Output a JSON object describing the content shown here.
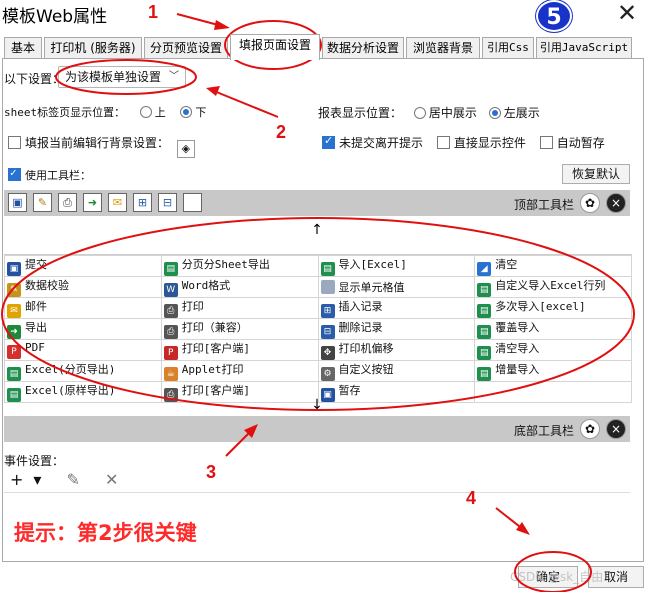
{
  "window": {
    "title": "模板Web属性"
  },
  "tabs": [
    {
      "label": "基本",
      "mono": false
    },
    {
      "label": "打印机 (服务器)",
      "mono": false
    },
    {
      "label": "分页预览设置",
      "mono": false
    },
    {
      "label": "填报页面设置",
      "mono": false,
      "active": true
    },
    {
      "label": "数据分析设置",
      "mono": false
    },
    {
      "label": "浏览器背景",
      "mono": false
    },
    {
      "label": "引用Css",
      "mono": true
    },
    {
      "label": "引用JavaScript",
      "mono": true
    }
  ],
  "settings": {
    "scope_label": "以下设置：",
    "scope_value": "为该模板单独设置",
    "sheet_tab_label": "sheet标签页显示位置：",
    "sheet_top": "上",
    "sheet_bottom": "下",
    "report_pos_label": "报表显示位置：",
    "report_center": "居中展示",
    "report_left": "左展示",
    "fill_row_bg": "填报当前编辑行背景设置：",
    "unsubmitted_leave": "未提交离开提示",
    "direct_show": "直接显示控件",
    "auto_save": "自动暂存",
    "use_toolbar": "使用工具栏：",
    "restore_default": "恢复默认"
  },
  "toolbar": {
    "top_label": "顶部工具栏",
    "bottom_label": "底部工具栏",
    "up_arrow": "↑",
    "down_arrow": "↓"
  },
  "grid": [
    [
      {
        "icon": "save",
        "t": "提交"
      },
      {
        "icon": "sheet",
        "t": "分页分Sheet导出"
      },
      {
        "icon": "sheet",
        "t": "导入[Excel]"
      },
      {
        "icon": "eraser",
        "t": "清空"
      }
    ],
    [
      {
        "icon": "pen",
        "t": "数据校验"
      },
      {
        "icon": "word",
        "t": "Word格式"
      },
      {
        "icon": "blank",
        "t": "显示单元格值"
      },
      {
        "icon": "sheet",
        "t": "自定义导入Excel行列"
      }
    ],
    [
      {
        "icon": "mail",
        "t": "邮件"
      },
      {
        "icon": "print",
        "t": "打印"
      },
      {
        "icon": "insert",
        "t": "插入记录"
      },
      {
        "icon": "sheet",
        "t": "多次导入[excel]"
      }
    ],
    [
      {
        "icon": "export",
        "t": "导出"
      },
      {
        "icon": "print",
        "t": "打印（兼容）"
      },
      {
        "icon": "delete",
        "t": "删除记录"
      },
      {
        "icon": "sheet",
        "t": "覆盖导入"
      }
    ],
    [
      {
        "icon": "pdf",
        "t": "PDF"
      },
      {
        "icon": "pdfprint",
        "t": "打印[客户端]"
      },
      {
        "icon": "move",
        "t": "打印机偏移"
      },
      {
        "icon": "sheet",
        "t": "清空导入"
      }
    ],
    [
      {
        "icon": "sheet",
        "t": "Excel(分页导出)"
      },
      {
        "icon": "applet",
        "t": "Applet打印"
      },
      {
        "icon": "gear",
        "t": "自定义按钮"
      },
      {
        "icon": "sheet",
        "t": "增量导入"
      }
    ],
    [
      {
        "icon": "sheet",
        "t": "Excel(原样导出)"
      },
      {
        "icon": "print",
        "t": "打印[客户端]"
      },
      {
        "icon": "save",
        "t": "暂存"
      },
      {
        "icon": "none",
        "t": ""
      }
    ]
  ],
  "events": {
    "label": "事件设置：",
    "add": "+▾",
    "edit": "✎",
    "remove": "✕"
  },
  "hint": "提示：第2步很关键",
  "buttons": {
    "ok": "确定",
    "cancel": "取消"
  },
  "watermark": "CSDN @sk_自由",
  "annotations": [
    "1",
    "2",
    "3",
    "4",
    "5"
  ],
  "colors": {
    "annotation_red": "#e01010",
    "badge_blue": "#1733c9",
    "check_blue": "#2a72d0"
  }
}
